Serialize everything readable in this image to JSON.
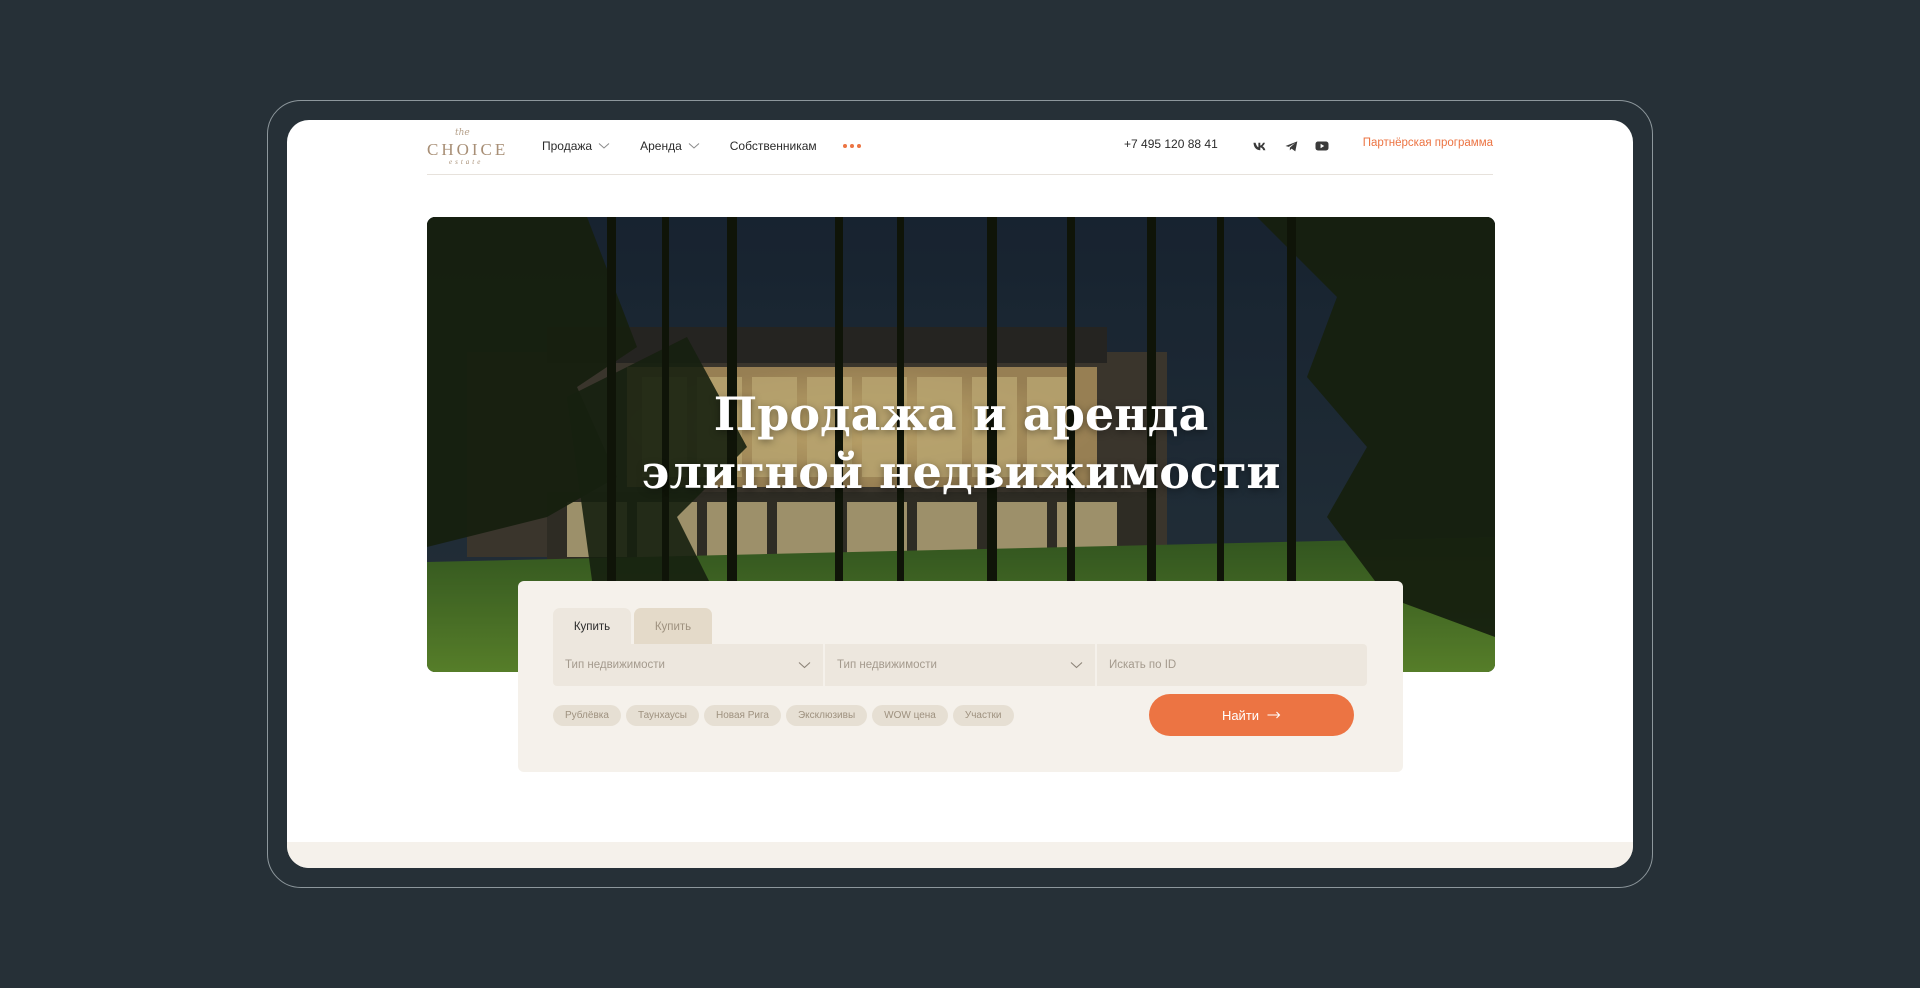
{
  "logo": {
    "script": "the",
    "main": "CHOICE",
    "sub": "estate"
  },
  "nav": {
    "items": [
      {
        "label": "Продажа",
        "has_dropdown": true
      },
      {
        "label": "Аренда",
        "has_dropdown": true
      },
      {
        "label": "Собственникам",
        "has_dropdown": false
      }
    ],
    "more_icon": "more-dots-icon"
  },
  "header": {
    "phone": "+7 495 120 88 41",
    "socials": [
      "vk-icon",
      "telegram-icon",
      "youtube-icon"
    ],
    "partner_link": "Партнёрская программа"
  },
  "hero": {
    "title_line1": "Продажа и аренда",
    "title_line2": "элитной недвижимости"
  },
  "search": {
    "tabs": [
      {
        "label": "Купить",
        "active": true
      },
      {
        "label": "Купить",
        "active": false
      }
    ],
    "fields": {
      "type1": "Тип недвижимости",
      "type2": "Тип недвижимости",
      "id_placeholder": "Искать по ID"
    },
    "chips": [
      "Рублёвка",
      "Таунхаусы",
      "Новая Рига",
      "Эксклюзивы",
      "WOW цена",
      "Участки"
    ],
    "button_label": "Найти"
  },
  "colors": {
    "page_bg": "#263037",
    "accent": "#ec7443",
    "card_bg": "#f5f1eb",
    "logo": "#a88f76"
  }
}
